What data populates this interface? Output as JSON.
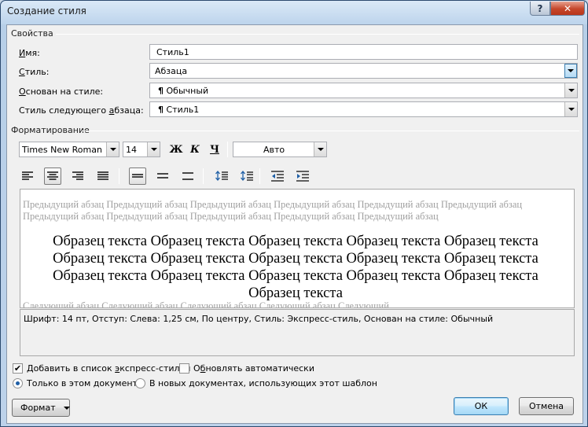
{
  "window": {
    "title": "Создание стиля",
    "help_label": "?",
    "close_label": "✕"
  },
  "properties": {
    "section_label": "Свойства",
    "name_label": "Имя:",
    "name_value": "Стиль1",
    "style_label": "Стиль:",
    "style_value": "Абзаца",
    "based_on_label": "Основан на стиле:",
    "based_on_value": "Обычный",
    "next_style_label": "Стиль следующего абзаца:",
    "next_style_value": "Стиль1",
    "paragraph_mark": "¶"
  },
  "formatting": {
    "section_label": "Форматирование",
    "font_value": "Times New Roman",
    "size_value": "14",
    "bold_label": "Ж",
    "italic_label": "К",
    "underline_label": "Ч",
    "color_value": "Авто"
  },
  "preview": {
    "previous_text": "Предыдущий абзац Предыдущий абзац Предыдущий абзац Предыдущий абзац Предыдущий абзац Предыдущий абзац Предыдущий абзац Предыдущий абзац Предыдущий абзац Предыдущий абзац Предыдущий абзац",
    "sample_text": "Образец текста Образец текста Образец текста Образец текста Образец текста Образец текста Образец текста Образец текста Образец текста Образец текста Образец текста Образец текста Образец текста Образец текста Образец текста Образец текста",
    "next_text": "Следующий абзац Следующий абзац Следующий абзац Следующий абзац Следующий"
  },
  "description": "Шрифт: 14 пт, Отступ: Слева:  1,25 см, По центру, Стиль: Экспресс-стиль, Основан на стиле: Обычный",
  "options": {
    "add_quick_styles": {
      "label": "Добавить в список экспресс-стилей",
      "checked": true
    },
    "auto_update": {
      "label": "Обновлять автоматически",
      "checked": false
    },
    "only_this_doc": {
      "label": "Только в этом документе",
      "selected": true
    },
    "new_docs": {
      "label": "В новых документах, использующих этот шаблон",
      "selected": false
    }
  },
  "buttons": {
    "format_label": "Формат",
    "ok_label": "ОК",
    "cancel_label": "Отмена"
  },
  "colors": {
    "accent": "#3c7fb1",
    "close": "#c5462b"
  }
}
